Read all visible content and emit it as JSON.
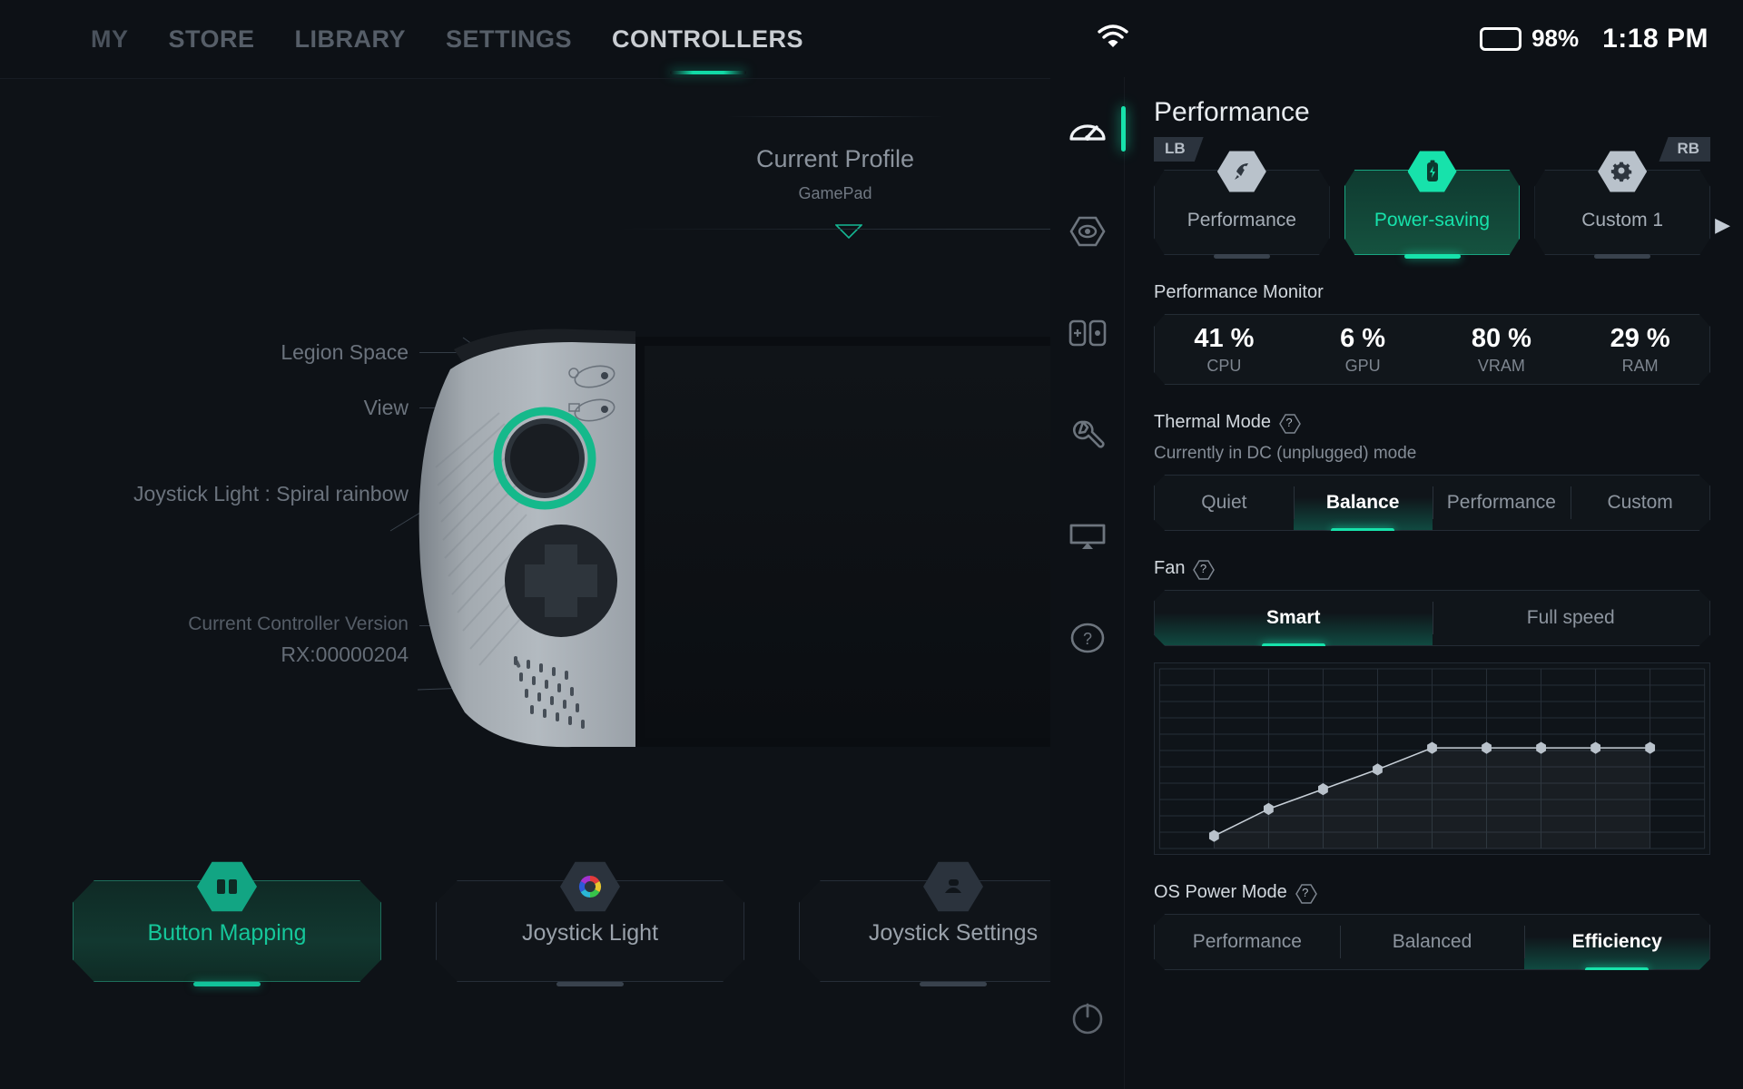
{
  "app": {
    "topnav": [
      {
        "label": "MY",
        "active": false
      },
      {
        "label": "STORE",
        "active": false
      },
      {
        "label": "LIBRARY",
        "active": false
      },
      {
        "label": "SETTINGS",
        "active": false
      },
      {
        "label": "CONTROLLERS",
        "active": true
      }
    ],
    "profile": {
      "title": "Current Profile",
      "name": "GamePad"
    },
    "annotations": [
      {
        "text": "Legion Space"
      },
      {
        "text": "View"
      },
      {
        "text": "Joystick Light : Spiral rainbow"
      }
    ],
    "controller_version": {
      "label": "Current Controller Version",
      "value": "RX:00000204"
    },
    "actions": [
      {
        "label": "Button Mapping",
        "icon": "button-mapping-icon",
        "selected": true
      },
      {
        "label": "Joystick Light",
        "icon": "color-wheel-icon",
        "selected": false
      },
      {
        "label": "Joystick Settings",
        "icon": "joystick-icon",
        "selected": false
      },
      {
        "label": "",
        "icon": "partial-icon",
        "selected": false
      }
    ]
  },
  "overlay": {
    "status": {
      "wifi_icon": "wifi-icon",
      "battery_percent": "98%",
      "battery_level": 98,
      "battery_color": "#27e839",
      "time": "1:18 PM"
    },
    "rail": [
      {
        "icon": "performance-gauge-icon",
        "name": "performance",
        "active": true
      },
      {
        "icon": "hex-eye-icon",
        "name": "display-eye",
        "active": false
      },
      {
        "icon": "controller-icon",
        "name": "controller",
        "active": false
      },
      {
        "icon": "wrench-icon",
        "name": "tools",
        "active": false
      },
      {
        "icon": "monitor-cast-icon",
        "name": "display-output",
        "active": false
      },
      {
        "icon": "help-circle-icon",
        "name": "help",
        "active": false
      }
    ],
    "rail_power_icon": "power-icon",
    "title": "Performance",
    "bumpers": {
      "left": "LB",
      "right": "RB"
    },
    "profiles": [
      {
        "label": "Performance",
        "icon": "rocket-icon",
        "selected": false
      },
      {
        "label": "Power-saving",
        "icon": "battery-bolt-icon",
        "selected": true
      },
      {
        "label": "Custom 1",
        "icon": "gear-cog-icon",
        "selected": false
      }
    ],
    "profiles_next_icon": "chevron-right-icon",
    "monitor": {
      "label": "Performance Monitor",
      "cells": [
        {
          "value": "41 %",
          "key": "CPU"
        },
        {
          "value": "6 %",
          "key": "GPU"
        },
        {
          "value": "80 %",
          "key": "VRAM"
        },
        {
          "value": "29 %",
          "key": "RAM"
        }
      ]
    },
    "thermal": {
      "label": "Thermal Mode",
      "help_icon": "help-hex-icon",
      "sub": "Currently in DC (unplugged) mode",
      "options": [
        {
          "label": "Quiet",
          "selected": false
        },
        {
          "label": "Balance",
          "selected": true
        },
        {
          "label": "Performance",
          "selected": false
        },
        {
          "label": "Custom",
          "selected": false
        }
      ]
    },
    "fan": {
      "label": "Fan",
      "help_icon": "help-hex-icon",
      "options": [
        {
          "label": "Smart",
          "selected": true
        },
        {
          "label": "Full speed",
          "selected": false
        }
      ]
    },
    "os_power": {
      "label": "OS Power Mode",
      "help_icon": "help-hex-icon",
      "options": [
        {
          "label": "Performance",
          "selected": false
        },
        {
          "label": "Balanced",
          "selected": false
        },
        {
          "label": "Efficiency",
          "selected": true
        }
      ]
    },
    "accent_color": "#17e2ab",
    "panel_bg": "#0d1116"
  },
  "chart_data": {
    "type": "line",
    "title": "Fan curve",
    "xlabel": "",
    "ylabel": "",
    "x": [
      1,
      2,
      3,
      4,
      5,
      6,
      7,
      8,
      9
    ],
    "values": [
      7,
      22,
      33,
      44,
      56,
      56,
      56,
      56,
      56
    ],
    "xlim": [
      0,
      10
    ],
    "ylim": [
      0,
      100
    ],
    "grid": true,
    "grid_cols": 10,
    "grid_rows": 11,
    "legend": "none",
    "point_color": "#b9c2cb",
    "line_color": "#c8d0d8"
  }
}
